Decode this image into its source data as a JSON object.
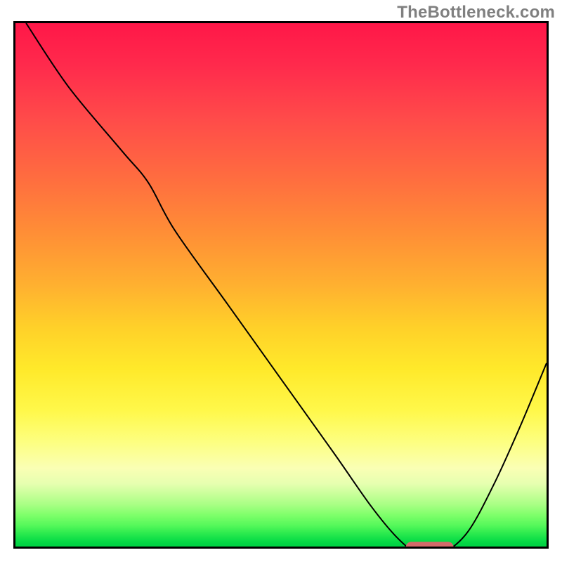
{
  "watermark": "TheBottleneck.com",
  "chart_data": {
    "type": "line",
    "title": "",
    "xlabel": "",
    "ylabel": "",
    "xlim": [
      0,
      100
    ],
    "ylim": [
      0,
      100
    ],
    "grid": false,
    "legend": false,
    "series": [
      {
        "name": "bottleneck-curve",
        "x": [
          2,
          10,
          20,
          25,
          30,
          40,
          50,
          60,
          67,
          72,
          76,
          80,
          85,
          90,
          95,
          100
        ],
        "y": [
          100,
          88,
          76,
          70,
          61,
          47,
          33,
          19,
          9,
          3,
          0,
          0,
          4,
          13,
          24,
          36
        ]
      }
    ],
    "marker": {
      "name": "optimal-range",
      "shape": "rounded-rect",
      "x_center": 78,
      "y_center": 1.3,
      "width": 9,
      "height": 2.1,
      "color": "#d46a6a"
    },
    "background_gradient": {
      "stops": [
        {
          "pos": 0,
          "color": "#ff1748"
        },
        {
          "pos": 0.4,
          "color": "#ff8e36"
        },
        {
          "pos": 0.66,
          "color": "#ffe92a"
        },
        {
          "pos": 0.85,
          "color": "#faffb4"
        },
        {
          "pos": 0.94,
          "color": "#7eff6a"
        },
        {
          "pos": 1.0,
          "color": "#00d243"
        }
      ]
    }
  }
}
